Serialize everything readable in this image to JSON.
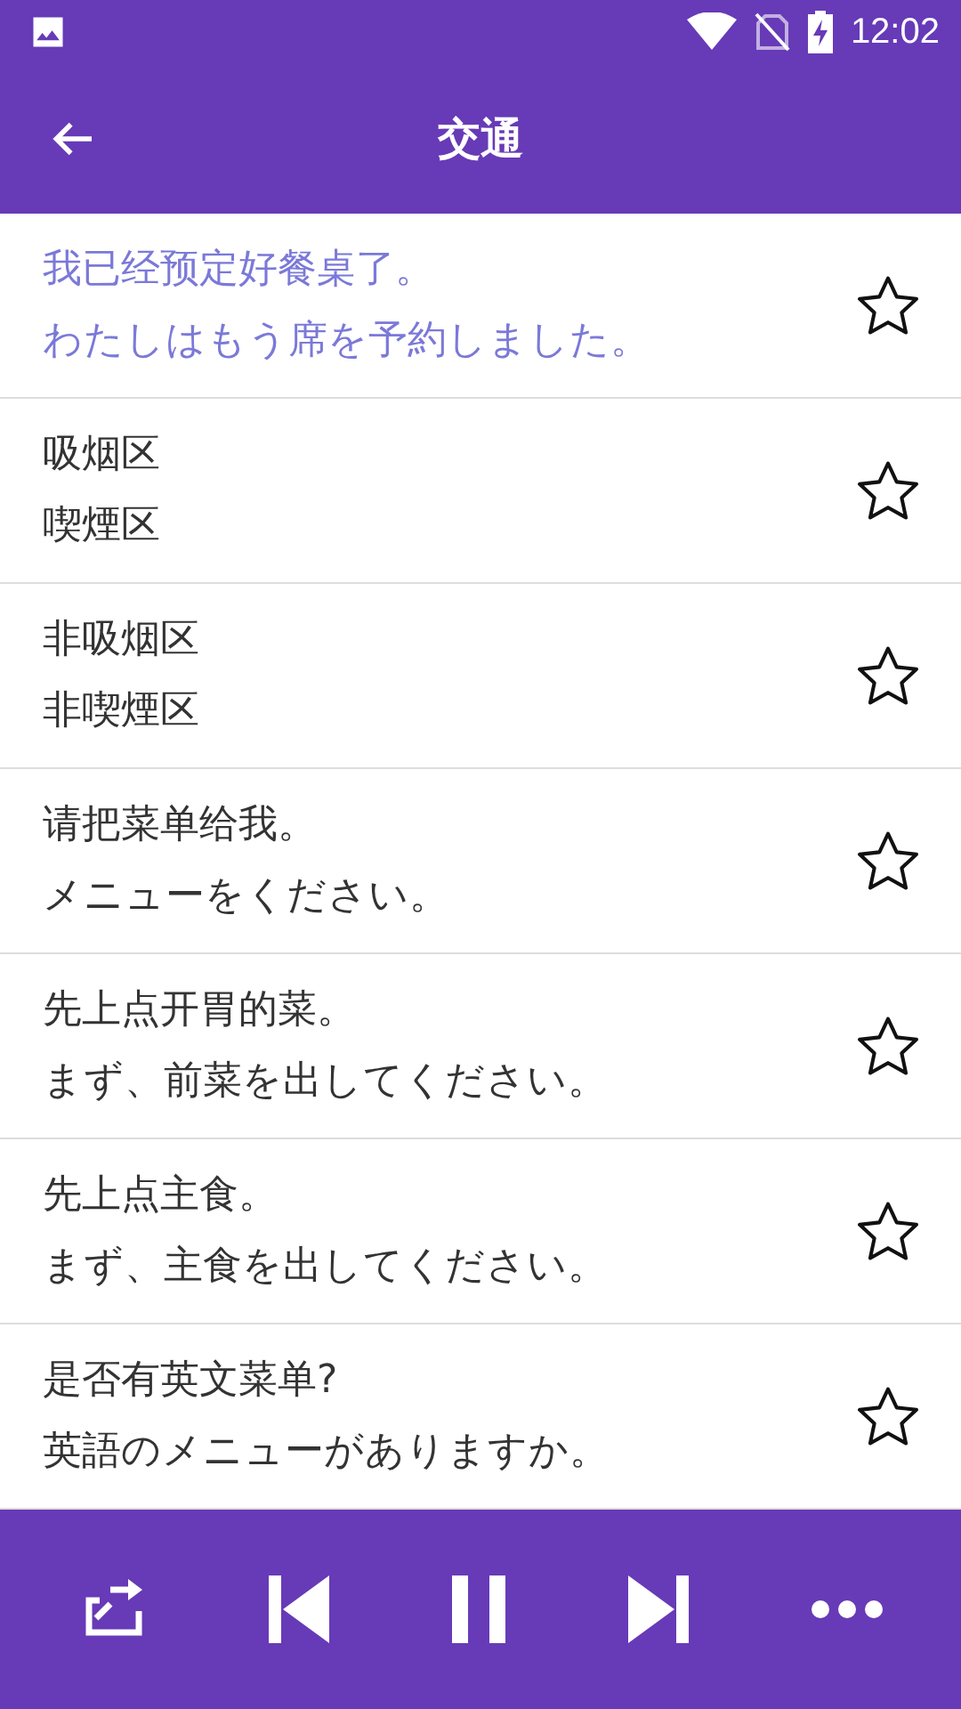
{
  "status_bar": {
    "time": "12:02"
  },
  "app_bar": {
    "title": "交通"
  },
  "phrases": [
    {
      "chinese": "我已经预定好餐桌了。",
      "japanese": "わたしはもう席を予約しました。",
      "selected": true,
      "favorite": false
    },
    {
      "chinese": "吸烟区",
      "japanese": "喫煙区",
      "selected": false,
      "favorite": false
    },
    {
      "chinese": "非吸烟区",
      "japanese": "非喫煙区",
      "selected": false,
      "favorite": false
    },
    {
      "chinese": "请把菜单给我。",
      "japanese": "メニューをください。",
      "selected": false,
      "favorite": false
    },
    {
      "chinese": "先上点开胃的菜。",
      "japanese": "まず、前菜を出してください。",
      "selected": false,
      "favorite": false
    },
    {
      "chinese": "先上点主食。",
      "japanese": "まず、主食を出してください。",
      "selected": false,
      "favorite": false
    },
    {
      "chinese": "是否有英文菜单?",
      "japanese": "英語のメニューがありますか。",
      "selected": false,
      "favorite": false
    }
  ],
  "player": {
    "playing": true
  }
}
